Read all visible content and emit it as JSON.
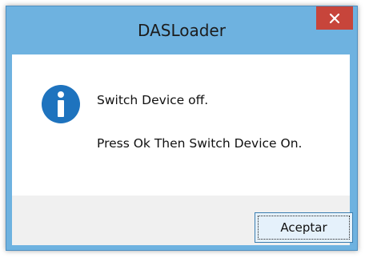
{
  "window": {
    "title": "DASLoader"
  },
  "titlebar": {
    "close_glyph": "✕",
    "close_icon": "close-icon"
  },
  "message": {
    "icon": "info-icon",
    "line1": "Switch Device off.",
    "line2": "Press Ok Then Switch Device On."
  },
  "buttons": {
    "ok_label": "Aceptar"
  },
  "colors": {
    "frame": "#6eb2e0",
    "close_button": "#c7453b",
    "info_icon": "#1e73be",
    "footer": "#f0f0f0",
    "button_border": "#3c7fb1"
  }
}
